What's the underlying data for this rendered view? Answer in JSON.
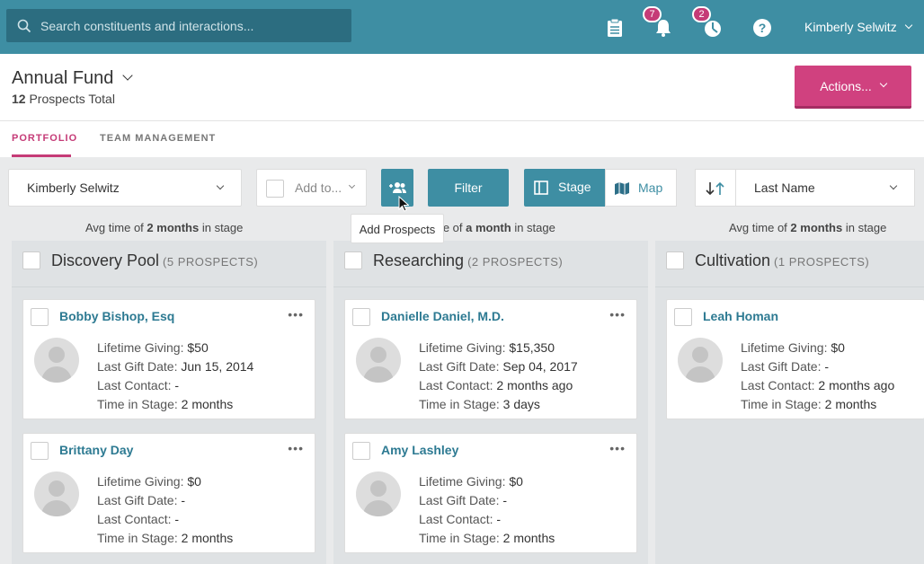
{
  "search": {
    "placeholder": "Search constituents and interactions..."
  },
  "notifications": {
    "bell_count": "7",
    "activity_count": "2"
  },
  "user": {
    "name": "Kimberly Selwitz"
  },
  "header": {
    "title": "Annual Fund",
    "prospects_count": "12",
    "prospects_label": "Prospects Total",
    "actions_label": "Actions..."
  },
  "tabs": [
    {
      "label": "PORTFOLIO"
    },
    {
      "label": "TEAM MANAGEMENT"
    }
  ],
  "toolbar": {
    "owner": "Kimberly Selwitz",
    "add_to": "Add to...",
    "filter": "Filter",
    "stage": "Stage",
    "map": "Map",
    "sort_field": "Last Name"
  },
  "tooltip": "Add Prospects",
  "avg": {
    "prefix": "Avg time of",
    "suffix": "in stage",
    "col1": "2 months",
    "col2": "a month",
    "col2_visible_prefix": "me of",
    "col3": "2 months"
  },
  "labels": {
    "lifetime": "Lifetime Giving:",
    "last_gift": "Last Gift Date:",
    "last_contact": "Last Contact:",
    "time_in_stage": "Time in Stage:"
  },
  "columns": [
    {
      "title": "Discovery Pool",
      "count": "(5 PROSPECTS)",
      "cards": [
        {
          "name": "Bobby Bishop, Esq",
          "lifetime": "$50",
          "last_gift": "Jun 15, 2014",
          "last_contact": "-",
          "time": "2 months"
        },
        {
          "name": "Brittany Day",
          "lifetime": "$0",
          "last_gift": "-",
          "last_contact": "-",
          "time": "2 months"
        }
      ]
    },
    {
      "title": "Researching",
      "count": "(2 PROSPECTS)",
      "cards": [
        {
          "name": "Danielle Daniel, M.D.",
          "lifetime": "$15,350",
          "last_gift": "Sep 04, 2017",
          "last_contact": "2 months ago",
          "time": "3 days"
        },
        {
          "name": "Amy Lashley",
          "lifetime": "$0",
          "last_gift": "-",
          "last_contact": "-",
          "time": "2 months"
        }
      ]
    },
    {
      "title": "Cultivation",
      "count": "(1 PROSPECTS)",
      "cards": [
        {
          "name": "Leah Homan",
          "lifetime": "$0",
          "last_gift": "-",
          "last_contact": "2 months ago",
          "time": "2 months"
        }
      ]
    }
  ],
  "colors": {
    "topbar": "#3e8ea3",
    "accent": "#c53b77",
    "actions": "#d0417f",
    "link": "#2d7a92"
  }
}
